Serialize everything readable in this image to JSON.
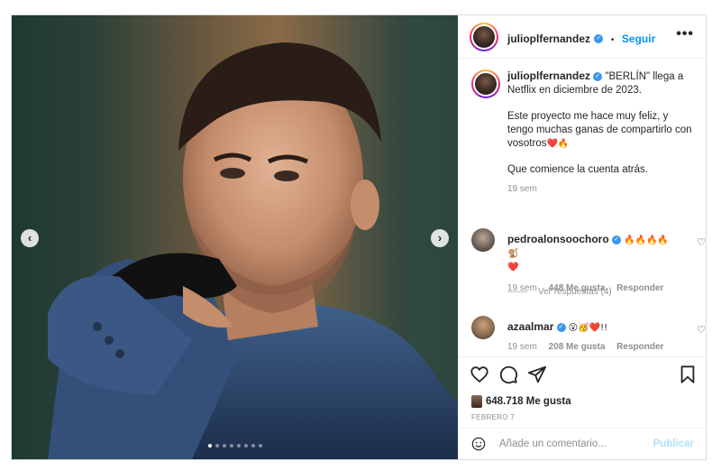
{
  "post": {
    "author": "julioplfernandez",
    "follow_label": "Seguir",
    "more_label": "•••",
    "dot_separator": "•",
    "image_count": 8,
    "active_image": 1
  },
  "caption": {
    "username": "julioplfernandez",
    "line1": "\"BERLÍN\" llega a Netflix en diciembre de 2023.",
    "line2": "Este proyecto me hace muy feliz, y tengo muchas ganas de compartirlo con vosotros",
    "line2_emoji": "❤️🔥",
    "line3": "Que comience la cuenta atrás.",
    "time": "19 sem"
  },
  "comments": [
    {
      "username": "pedroalonsoochoro",
      "text": "🔥🔥🔥🔥🐒",
      "text2": "❤️",
      "time": "19 sem",
      "likes": "448 Me gusta",
      "reply": "Responder"
    },
    {
      "username": "azaalmar",
      "text": "😮🥳❤️!!",
      "time": "19 sem",
      "likes": "208 Me gusta",
      "reply": "Responder"
    }
  ],
  "view_replies": "Ver respuestas (4)",
  "likes_count": "648.718 Me gusta",
  "date": "FEBRERO 7",
  "add_comment": {
    "placeholder": "Añade un comentario...",
    "publish": "Publicar"
  },
  "colors": {
    "accent": "#0095f6",
    "verified": "#3897f0",
    "muted": "#8e8e8e",
    "publish_disabled": "#b2dffc"
  }
}
